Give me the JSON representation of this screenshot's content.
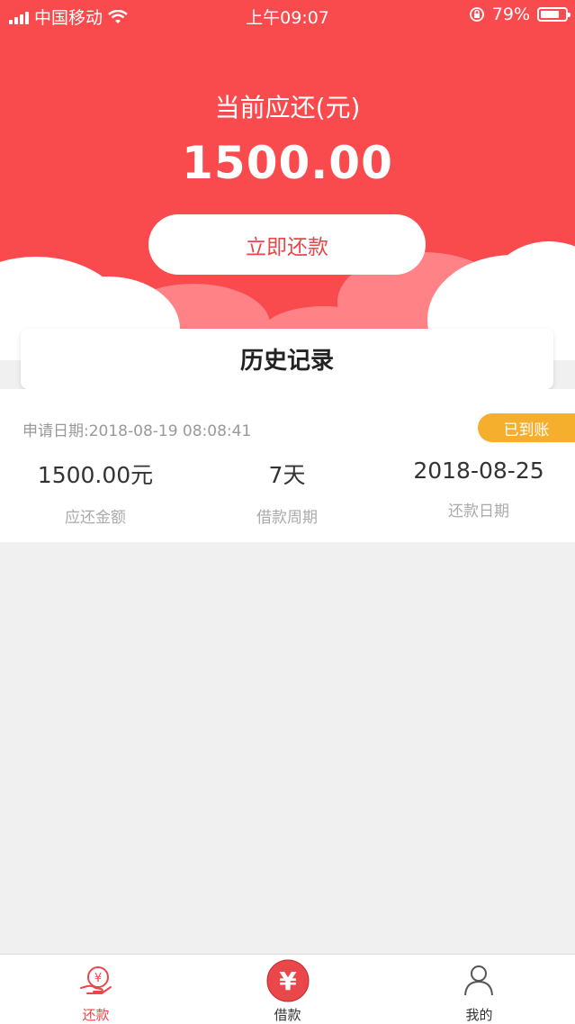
{
  "status_bar": {
    "carrier": "中国移动",
    "time": "上午09:07",
    "battery": "79%",
    "battery_level": 0.79
  },
  "hero": {
    "title": "当前应还(元)",
    "amount": "1500.00",
    "repay_button": "立即还款"
  },
  "history": {
    "title": "历史记录",
    "record": {
      "apply_date": "申请日期:2018-08-19 08:08:41",
      "status": "已到账",
      "amount": "1500.00元",
      "amount_label": "应还金额",
      "period": "7天",
      "period_label": "借款周期",
      "due_date": "2018-08-25",
      "due_date_label": "还款日期"
    }
  },
  "tabbar": {
    "items": [
      {
        "label": "还款",
        "icon": "hand-coin-icon",
        "active": true
      },
      {
        "label": "借款",
        "icon": "yuan-coin-icon",
        "active": false
      },
      {
        "label": "我的",
        "icon": "user-icon",
        "active": false
      }
    ]
  },
  "colors": {
    "brand_red": "#f94a4d",
    "badge_orange": "#f6ae2d"
  }
}
